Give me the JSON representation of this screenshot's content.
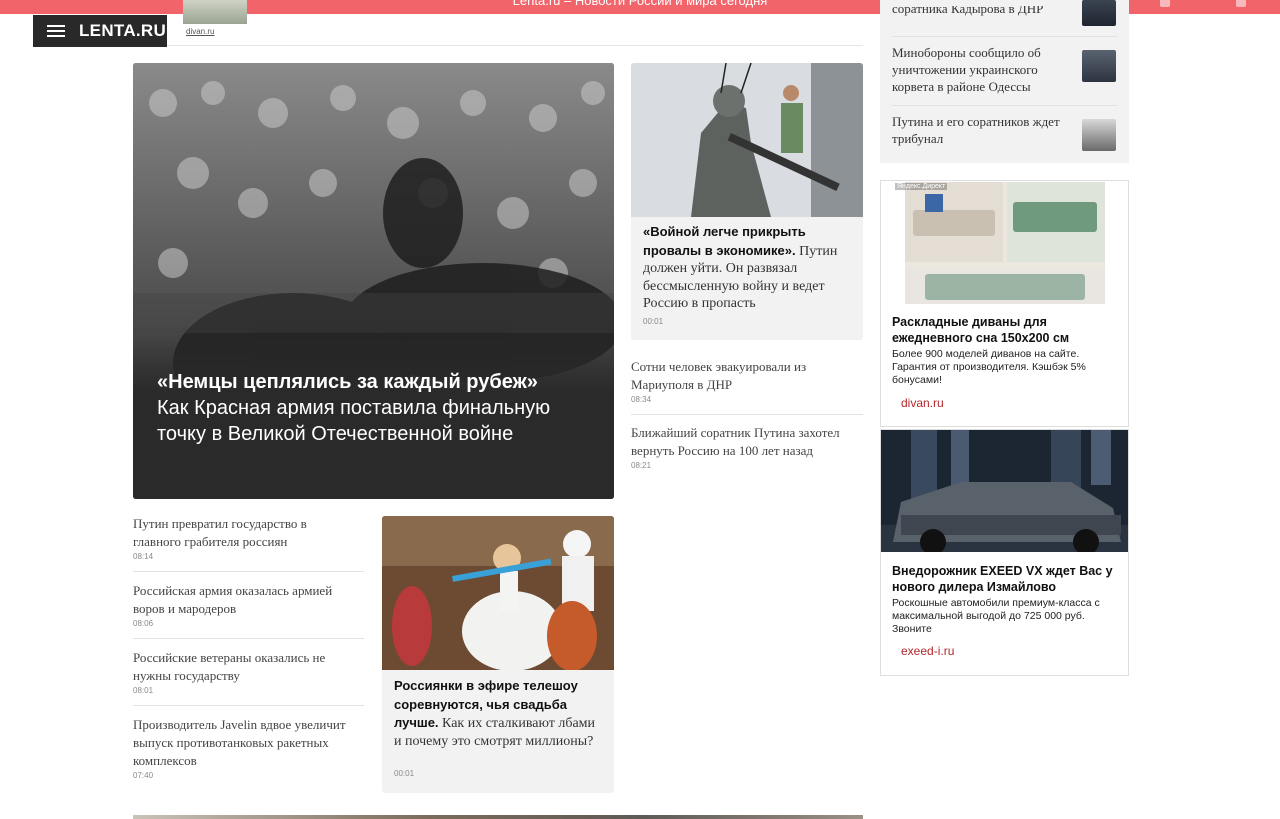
{
  "browser": {
    "tab_title": "Lenta.ru – Новости России и мира сегодня"
  },
  "header": {
    "logo_text": "LENTA.RU"
  },
  "top_fragment": {
    "source": "divan.ru"
  },
  "feature": {
    "headline_bold": "«Немцы цеплялись за каждый рубеж»",
    "headline_rest": "Как Красная армия поставила финальную точку в Великой Отечественной войне"
  },
  "card_war": {
    "bold": "«Войной легче прикрыть провалы в экономике».",
    "rest": " Путин должен уйти. Он развязал бессмысленную войну и ведет Россию в пропасть",
    "time": "00:01"
  },
  "right_news": [
    {
      "title": "Сотни человек эвакуировали из Мариуполя в ДНР",
      "time": "08:34"
    },
    {
      "title": "Ближайший соратник Путина захотел вернуть Россию на 100 лет назад",
      "time": "08:21"
    }
  ],
  "left_news": [
    {
      "title": "Путин превратил государство в главного грабителя россиян",
      "time": "08:14"
    },
    {
      "title": "Российская армия оказалась армией воров и мародеров",
      "time": "08:06"
    },
    {
      "title": "Российские ветераны оказались не нужны государству",
      "time": "08:01"
    },
    {
      "title": "Производитель Javelin вдвое увеличит выпуск противотанковых ракетных комплексов",
      "time": "07:40"
    }
  ],
  "card_wedding": {
    "bold": "Россиянки в эфире телешоу соревнуются, чья свадьба лучше.",
    "rest": " Как их сталкивают лбами и почему это смотрят миллионы?",
    "time": "00:01"
  },
  "sidebar": {
    "items": [
      {
        "title": "соратника Кадырова в ДНР"
      },
      {
        "title": "Минобороны сообщило об уничтожении украинского корвета в районе Одессы"
      },
      {
        "title": "Путина и его соратников ждет трибунал"
      }
    ]
  },
  "ads": [
    {
      "label": "Яндекс.Директ",
      "title": "Раскладные диваны для ежедневного сна 150х200 см",
      "description": "Более 900 моделей диванов на сайте. Гарантия от производителя. Кэшбэк 5% бонусами!",
      "domain": "divan.ru"
    },
    {
      "title": "Внедорожник EXEED VX ждет Вас у нового дилера Измайлово",
      "description": "Роскошные автомобили премиум-класса с максимальной выгодой до 725 000 руб. Звоните",
      "domain": "exeed-i.ru"
    }
  ],
  "colors": {
    "accent": "#f0646a",
    "logo_bg": "#292929",
    "ad_link": "#b3262c",
    "card_bg": "#f2f2f2"
  }
}
